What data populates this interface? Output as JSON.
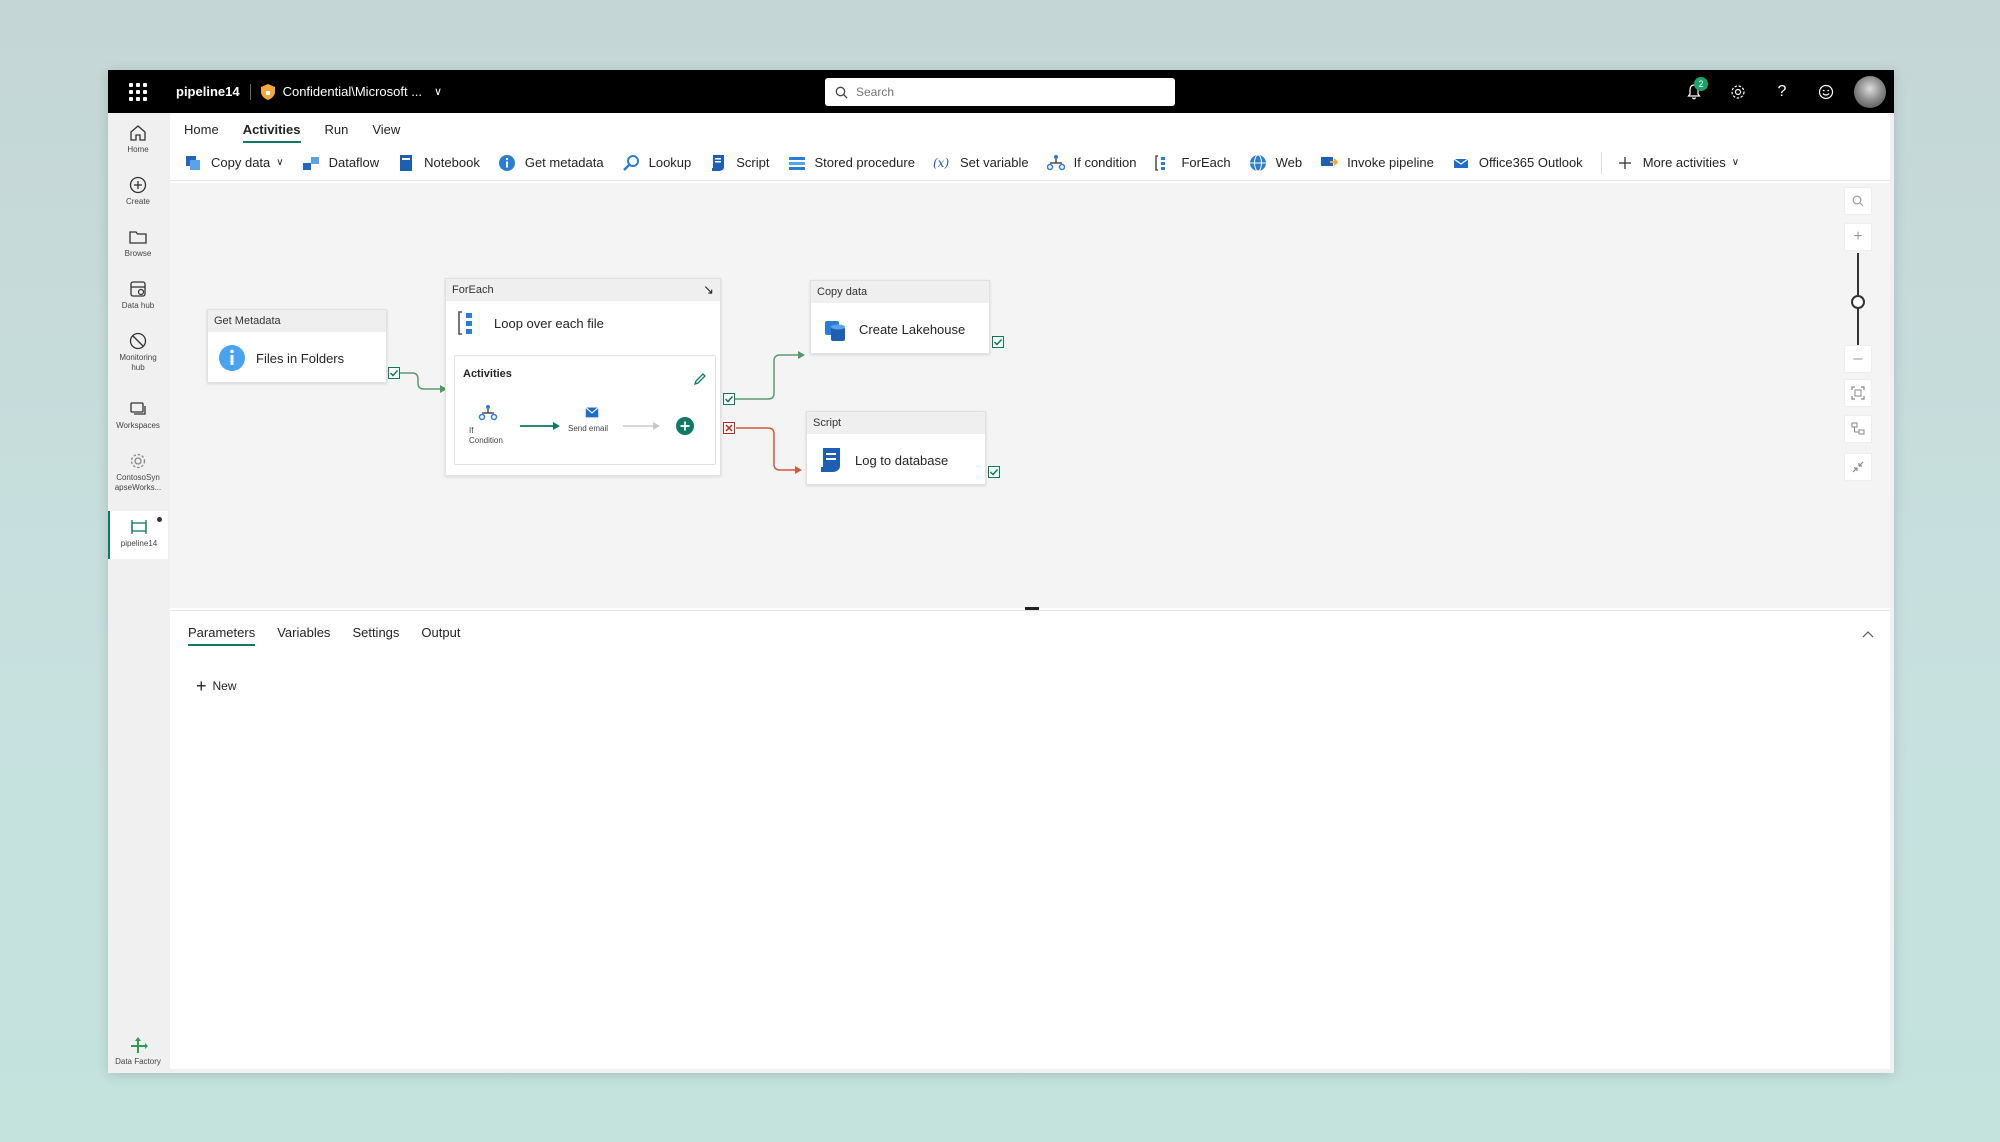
{
  "topbar": {
    "app_title": "pipeline14",
    "sensitivity": "Confidential\\Microsoft ...",
    "search_placeholder": "Search",
    "notification_count": "2"
  },
  "rail": {
    "home": "Home",
    "create": "Create",
    "browse": "Browse",
    "data_hub": "Data hub",
    "monitoring_1": "Monitoring",
    "monitoring_2": "hub",
    "workspaces": "Workspaces",
    "workspace_1": "ContosoSyn",
    "workspace_2": "apseWorks...",
    "pipeline": "pipeline14",
    "data_factory": "Data Factory"
  },
  "menu": {
    "home": "Home",
    "activities": "Activities",
    "run": "Run",
    "view": "View"
  },
  "ribbon": {
    "copy_data": "Copy data",
    "dataflow": "Dataflow",
    "notebook": "Notebook",
    "get_metadata": "Get metadata",
    "lookup": "Lookup",
    "script": "Script",
    "stored_procedure": "Stored procedure",
    "set_variable": "Set variable",
    "if_condition": "If condition",
    "foreach": "ForEach",
    "web": "Web",
    "invoke_pipeline": "Invoke pipeline",
    "office365": "Office365 Outlook",
    "more": "More activities"
  },
  "canvas": {
    "get_metadata": {
      "type": "Get Metadata",
      "name": "Files in Folders"
    },
    "foreach": {
      "type": "ForEach",
      "name": "Loop over each file",
      "activities_label": "Activities",
      "inner_if_1": "If",
      "inner_if_2": "Condition",
      "inner_send": "Send email"
    },
    "copy_data": {
      "type": "Copy data",
      "name": "Create Lakehouse"
    },
    "script": {
      "type": "Script",
      "name": "Log to database"
    }
  },
  "panel": {
    "tabs": [
      "Parameters",
      "Variables",
      "Settings",
      "Output"
    ],
    "new_label": "New"
  },
  "colors": {
    "accent": "#117865",
    "success": "#0b7b52",
    "failure": "#c42b1c"
  }
}
